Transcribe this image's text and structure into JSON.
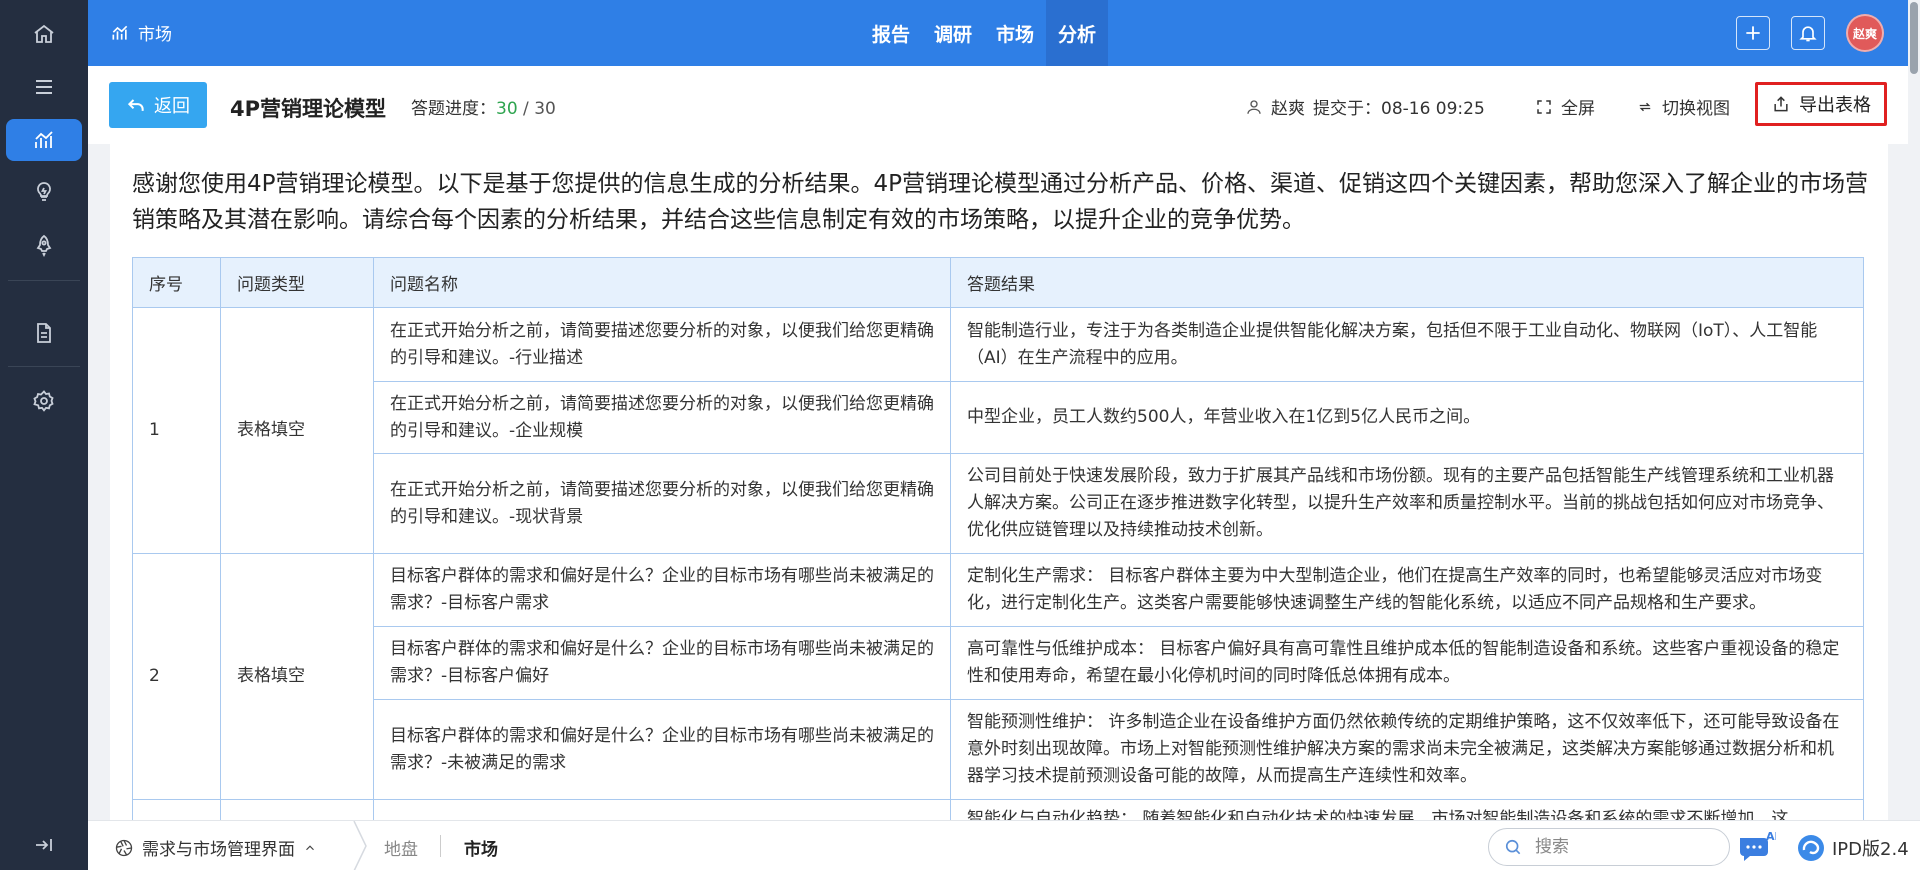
{
  "sidebar": {
    "items": [
      {
        "icon": "home-icon"
      },
      {
        "icon": "menu-icon"
      },
      {
        "icon": "chart-trend-icon",
        "active": true
      },
      {
        "icon": "lightbulb-icon"
      },
      {
        "icon": "rocket-icon"
      },
      {
        "icon": "document-icon"
      },
      {
        "icon": "gear-icon"
      },
      {
        "icon": "collapse-icon"
      }
    ]
  },
  "header": {
    "brand_label": "市场",
    "tabs": [
      {
        "label": "报告",
        "active": false
      },
      {
        "label": "调研",
        "active": false
      },
      {
        "label": "市场",
        "active": false
      },
      {
        "label": "分析",
        "active": true
      }
    ],
    "avatar_text": "赵爽"
  },
  "toolbar": {
    "back_label": "返回",
    "title": "4P营销理论模型",
    "progress_label": "答题进度：",
    "progress_done": "30",
    "progress_sep": " / ",
    "progress_total": "30",
    "user_name": "赵爽",
    "submitted_label": "提交于：08-16 09:25",
    "fullscreen_label": "全屏",
    "switch_view_label": "切换视图",
    "export_label": "导出表格"
  },
  "content": {
    "intro": "感谢您使用4P营销理论模型。以下是基于您提供的信息生成的分析结果。4P营销理论模型通过分析产品、价格、渠道、促销这四个关键因素，帮助您深入了解企业的市场营销策略及其潜在影响。请综合每个因素的分析结果，并结合这些信息制定有效的市场策略，以提升企业的竞争优势。",
    "table": {
      "headers": [
        "序号",
        "问题类型",
        "问题名称",
        "答题结果"
      ],
      "groups": [
        {
          "index": "1",
          "type": "表格填空",
          "rows": [
            {
              "question": "在正式开始分析之前，请简要描述您要分析的对象，以便我们给您更精确的引导和建议。-行业描述",
              "answer": "智能制造行业，专注于为各类制造企业提供智能化解决方案，包括但不限于工业自动化、物联网（IoT）、人工智能（AI）在生产流程中的应用。"
            },
            {
              "question": "在正式开始分析之前，请简要描述您要分析的对象，以便我们给您更精确的引导和建议。-企业规模",
              "answer": "中型企业，员工人数约500人，年营业收入在1亿到5亿人民币之间。"
            },
            {
              "question": "在正式开始分析之前，请简要描述您要分析的对象，以便我们给您更精确的引导和建议。-现状背景",
              "answer": "公司目前处于快速发展阶段，致力于扩展其产品线和市场份额。现有的主要产品包括智能生产线管理系统和工业机器人解决方案。公司正在逐步推进数字化转型，以提升生产效率和质量控制水平。当前的挑战包括如何应对市场竞争、优化供应链管理以及持续推动技术创新。"
            }
          ]
        },
        {
          "index": "2",
          "type": "表格填空",
          "rows": [
            {
              "question": "目标客户群体的需求和偏好是什么？企业的目标市场有哪些尚未被满足的需求？-目标客户需求",
              "answer": "定制化生产需求： 目标客户群体主要为中大型制造企业，他们在提高生产效率的同时，也希望能够灵活应对市场变化，进行定制化生产。这类客户需要能够快速调整生产线的智能化系统，以适应不同产品规格和生产要求。"
            },
            {
              "question": "目标客户群体的需求和偏好是什么？企业的目标市场有哪些尚未被满足的需求？-目标客户偏好",
              "answer": "高可靠性与低维护成本： 目标客户偏好具有高可靠性且维护成本低的智能制造设备和系统。这些客户重视设备的稳定性和使用寿命，希望在最小化停机时间的同时降低总体拥有成本。"
            },
            {
              "question": "目标客户群体的需求和偏好是什么？企业的目标市场有哪些尚未被满足的需求？-未被满足的需求",
              "answer": "智能预测性维护： 许多制造企业在设备维护方面仍然依赖传统的定期维护策略，这不仅效率低下，还可能导致设备在意外时刻出现故障。市场上对智能预测性维护解决方案的需求尚未完全被满足，这类解决方案能够通过数据分析和机器学习技术提前预测设备可能的故障，从而提高生产连续性和效率。"
            }
          ]
        },
        {
          "index": "",
          "type": "",
          "rows": [
            {
              "question": "",
              "answer": "智能化与自动化趋势： 随着智能化和自动化技术的快速发展，市场对智能制造设备和系统的需求不断增加，这"
            }
          ]
        }
      ]
    }
  },
  "bottombar": {
    "root_label": "需求与市场管理界面",
    "crumbs": [
      {
        "label": "地盘",
        "active": false
      },
      {
        "label": "市场",
        "active": true
      }
    ],
    "search_placeholder": "搜索",
    "ai_badge": "AI",
    "version": "IPD版2.4"
  },
  "colors": {
    "primary": "#2f7fe6",
    "sidebar": "#242e40",
    "back_button": "#35a6f0",
    "export_border": "#e02020",
    "progress_done": "#2ea44f",
    "table_header": "#e6f1fd"
  }
}
